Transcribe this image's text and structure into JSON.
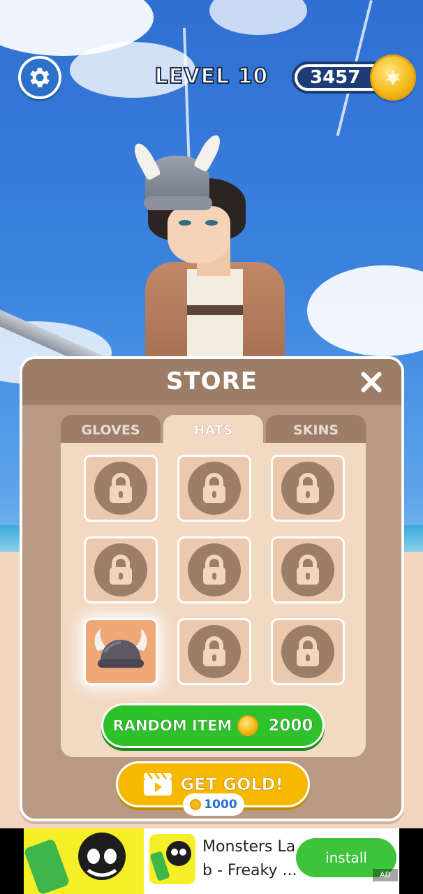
{
  "hud": {
    "level_label": "LEVEL 10",
    "coin_count": "3457",
    "settings_icon": "gear-icon",
    "coin_icon": "gold-coin-icon"
  },
  "store": {
    "title": "STORE",
    "close_icon": "close-icon",
    "tabs": [
      {
        "label": "GLOVES",
        "active": false
      },
      {
        "label": "HATS",
        "active": true
      },
      {
        "label": "SKINS",
        "active": false
      }
    ],
    "items": [
      {
        "state": "locked"
      },
      {
        "state": "locked"
      },
      {
        "state": "locked"
      },
      {
        "state": "locked"
      },
      {
        "state": "locked"
      },
      {
        "state": "locked"
      },
      {
        "state": "owned",
        "item": "viking-helmet"
      },
      {
        "state": "locked"
      },
      {
        "state": "locked"
      }
    ],
    "random_item": {
      "label": "RANDOM ITEM",
      "price": "2000"
    },
    "get_gold": {
      "label": "GET GOLD!",
      "reward": "1000"
    }
  },
  "ad": {
    "title": "Monsters Lab - Freaky ...",
    "install_label": "install",
    "badge": "AD"
  },
  "colors": {
    "panel": "#b89a84",
    "panel_header": "#9c7d68",
    "panel_inner": "#f2d9c4",
    "random_button": "#2dc22a",
    "gold_button": "#f7b800",
    "coin_pill": "#1d3b75",
    "install_button": "#3ec33d"
  }
}
